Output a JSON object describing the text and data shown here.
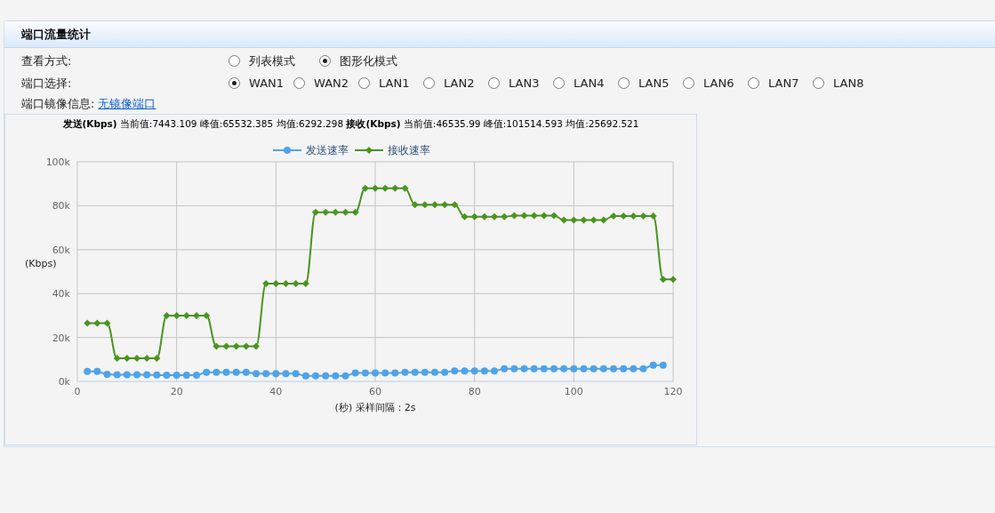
{
  "panel": {
    "title": "端口流量统计"
  },
  "view_mode": {
    "label": "查看方式:",
    "options": [
      {
        "label": "列表模式",
        "selected": false
      },
      {
        "label": "图形化模式",
        "selected": true
      }
    ]
  },
  "port_select": {
    "label": "端口选择:",
    "options": [
      {
        "label": "WAN1",
        "selected": true
      },
      {
        "label": "WAN2",
        "selected": false
      },
      {
        "label": "LAN1",
        "selected": false
      },
      {
        "label": "LAN2",
        "selected": false
      },
      {
        "label": "LAN3",
        "selected": false
      },
      {
        "label": "LAN4",
        "selected": false
      },
      {
        "label": "LAN5",
        "selected": false
      },
      {
        "label": "LAN6",
        "selected": false
      },
      {
        "label": "LAN7",
        "selected": false
      },
      {
        "label": "LAN8",
        "selected": false
      }
    ]
  },
  "mirror": {
    "label": "端口镜像信息:",
    "link": "无镜像端口"
  },
  "chart": {
    "chart_data": {
      "type": "line",
      "title": "**发送(Kbps)** 当前值:7443.109 峰值:65532.385 均值:6292.298  **接收(Kbps)** 当前值:46535.99 峰值:101514.593 均值:25692.521",
      "xlabel": "(秒) 采样间隔：2s",
      "ylabel": "(Kbps)",
      "x": [
        2,
        4,
        6,
        8,
        10,
        12,
        14,
        16,
        18,
        20,
        22,
        24,
        26,
        28,
        30,
        32,
        34,
        36,
        38,
        40,
        42,
        44,
        46,
        48,
        50,
        52,
        54,
        56,
        58,
        60,
        62,
        64,
        66,
        68,
        70,
        72,
        74,
        76,
        78,
        80,
        82,
        84,
        86,
        88,
        90,
        92,
        94,
        96,
        98,
        100,
        102,
        104,
        106,
        108,
        110,
        112,
        114,
        116,
        118,
        120
      ],
      "series": [
        {
          "name": "发送速率",
          "color": "#4fa3e8",
          "marker": "circle",
          "values": [
            4600,
            4600,
            3200,
            3000,
            3000,
            3000,
            3000,
            2900,
            2800,
            2800,
            2800,
            2800,
            4200,
            4200,
            4200,
            4200,
            4200,
            3500,
            3500,
            3500,
            3500,
            3500,
            2500,
            2500,
            2500,
            2500,
            2500,
            3800,
            3800,
            3800,
            3800,
            3800,
            4200,
            4200,
            4200,
            4200,
            4200,
            4800,
            4800,
            4800,
            4800,
            4800,
            5800,
            5800,
            5800,
            5800,
            5800,
            5800,
            5800,
            5800,
            5800,
            5800,
            5800,
            5800,
            5800,
            5800,
            5800,
            7400,
            7400,
            null
          ]
        },
        {
          "name": "接收速率",
          "color": "#4a9420",
          "marker": "diamond",
          "values": [
            26500,
            26500,
            26500,
            10500,
            10500,
            10500,
            10500,
            10500,
            30000,
            30000,
            30000,
            30000,
            30000,
            16000,
            16000,
            16000,
            16000,
            16000,
            44500,
            44500,
            44500,
            44500,
            44500,
            77000,
            77000,
            77000,
            77000,
            77000,
            88000,
            88000,
            88000,
            88000,
            88000,
            80500,
            80500,
            80500,
            80500,
            80500,
            75000,
            75000,
            75000,
            75000,
            75000,
            75500,
            75500,
            75500,
            75500,
            75500,
            73500,
            73500,
            73500,
            73500,
            73500,
            75300,
            75300,
            75300,
            75300,
            75300,
            46500,
            46500
          ]
        }
      ],
      "grid": true,
      "xlim": [
        0,
        120
      ],
      "ylim": [
        0,
        100000
      ],
      "xticks": [
        0,
        20,
        40,
        60,
        80,
        100,
        120
      ],
      "yticks": [
        {
          "value": 0,
          "label": "0k"
        },
        {
          "value": 20000,
          "label": "20k"
        },
        {
          "value": 40000,
          "label": "40k"
        },
        {
          "value": 60000,
          "label": "60k"
        },
        {
          "value": 80000,
          "label": "80k"
        },
        {
          "value": 100000,
          "label": "100k"
        }
      ]
    }
  }
}
